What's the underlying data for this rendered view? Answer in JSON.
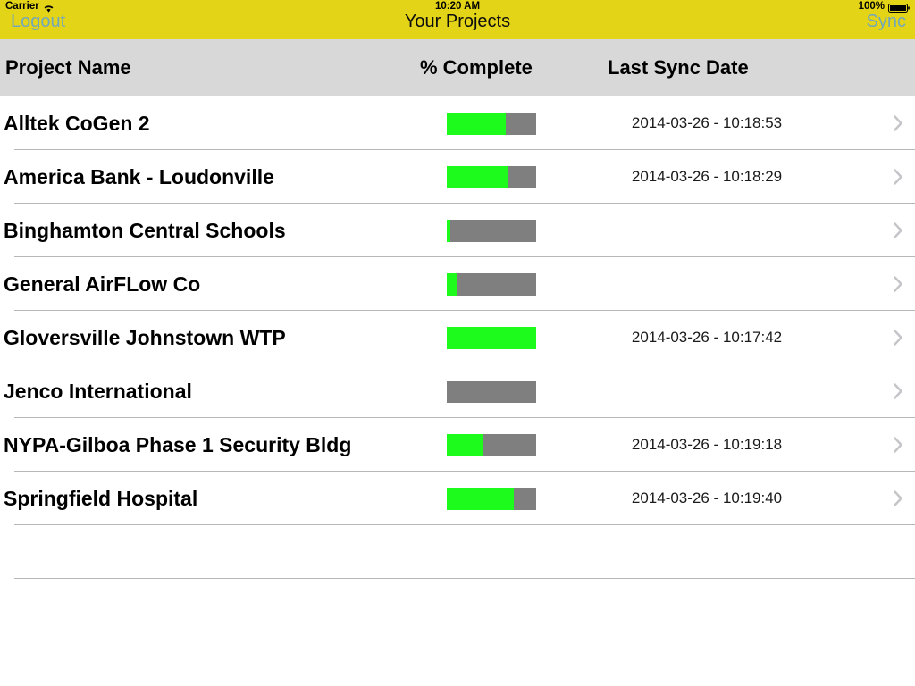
{
  "status_bar": {
    "carrier": "Carrier",
    "wifi_icon": "wifi-icon",
    "time": "10:20 AM",
    "battery_percent": "100%",
    "battery_icon": "battery-full-icon"
  },
  "nav_bar": {
    "left_button": "Logout",
    "title": "Your Projects",
    "right_button": "Sync",
    "background_color": "#e3d418",
    "button_color": "#74a8b8"
  },
  "table": {
    "columns": {
      "name": "Project Name",
      "percent_complete": "% Complete",
      "last_sync_date": "Last Sync Date"
    },
    "header_background": "#d8d8d8",
    "progress_fill_color": "#1dfb1d",
    "progress_track_color": "#7f7f7f",
    "disclosure_icon": "chevron-right-icon",
    "rows": [
      {
        "name": "Alltek CoGen 2",
        "percent": 66,
        "last_sync": "2014-03-26 - 10:18:53"
      },
      {
        "name": "America Bank - Loudonville",
        "percent": 68,
        "last_sync": "2014-03-26 - 10:18:29"
      },
      {
        "name": "Binghamton Central Schools",
        "percent": 4,
        "last_sync": ""
      },
      {
        "name": "General AirFLow Co",
        "percent": 11,
        "last_sync": ""
      },
      {
        "name": "Gloversville Johnstown WTP",
        "percent": 100,
        "last_sync": "2014-03-26 - 10:17:42"
      },
      {
        "name": "Jenco International",
        "percent": 0,
        "last_sync": ""
      },
      {
        "name": "NYPA-Gilboa Phase 1 Security Bldg",
        "percent": 40,
        "last_sync": "2014-03-26 - 10:19:18"
      },
      {
        "name": "Springfield Hospital",
        "percent": 75,
        "last_sync": "2014-03-26 - 10:19:40"
      }
    ],
    "empty_rows": 2
  }
}
